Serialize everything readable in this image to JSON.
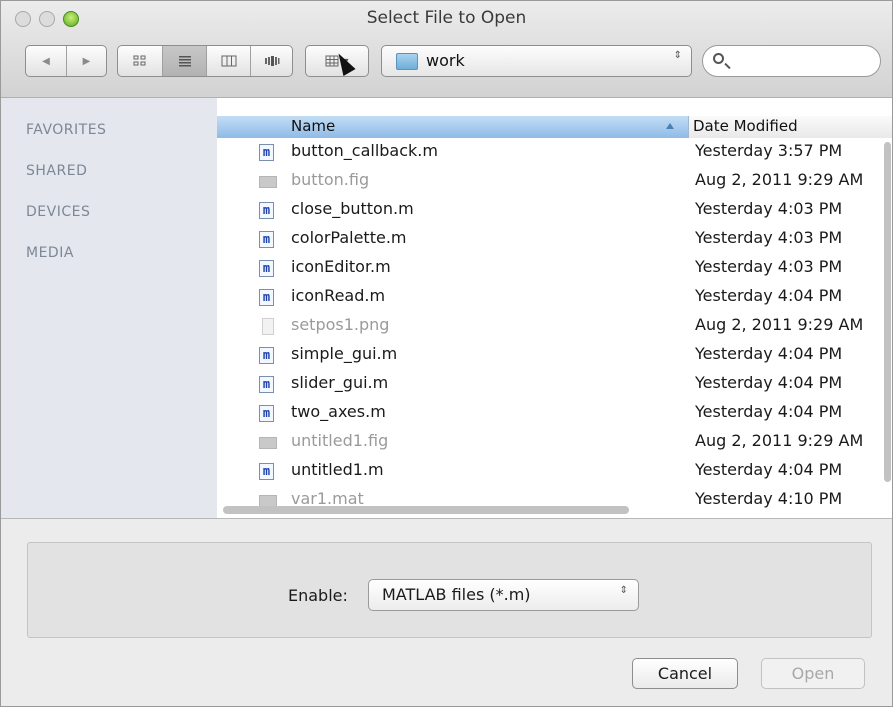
{
  "window": {
    "title": "Select File to Open"
  },
  "toolbar": {
    "back_glyph": "◀",
    "forward_glyph": "▶",
    "view_icons": [
      "icon-view-icon",
      "list-view-icon",
      "column-view-icon",
      "coverflow-view-icon"
    ],
    "arrange_glyph": "▾",
    "location": "work",
    "updown_glyph": "⇕",
    "search": {
      "placeholder": ""
    }
  },
  "sidebar": {
    "items": [
      {
        "label": "FAVORITES"
      },
      {
        "label": "SHARED"
      },
      {
        "label": "DEVICES"
      },
      {
        "label": "MEDIA"
      }
    ]
  },
  "filelist": {
    "columns": {
      "name": "Name",
      "date": "Date Modified"
    },
    "rows": [
      {
        "name": "button_callback.m",
        "date": "Yesterday 3:57 PM",
        "icon": "m",
        "dim": false
      },
      {
        "name": "button.fig",
        "date": "Aug 2, 2011 9:29 AM",
        "icon": "fig",
        "dim": true
      },
      {
        "name": "close_button.m",
        "date": "Yesterday 4:03 PM",
        "icon": "m",
        "dim": false
      },
      {
        "name": "colorPalette.m",
        "date": "Yesterday 4:03 PM",
        "icon": "m",
        "dim": false
      },
      {
        "name": "iconEditor.m",
        "date": "Yesterday 4:03 PM",
        "icon": "m",
        "dim": false
      },
      {
        "name": "iconRead.m",
        "date": "Yesterday 4:04 PM",
        "icon": "m",
        "dim": false
      },
      {
        "name": "setpos1.png",
        "date": "Aug 2, 2011 9:29 AM",
        "icon": "png",
        "dim": true
      },
      {
        "name": "simple_gui.m",
        "date": "Yesterday 4:04 PM",
        "icon": "m",
        "dim": false
      },
      {
        "name": "slider_gui.m",
        "date": "Yesterday 4:04 PM",
        "icon": "m",
        "dim": false
      },
      {
        "name": "two_axes.m",
        "date": "Yesterday 4:04 PM",
        "icon": "m",
        "dim": false
      },
      {
        "name": "untitled1.fig",
        "date": "Aug 2, 2011 9:29 AM",
        "icon": "fig",
        "dim": true
      },
      {
        "name": "untitled1.m",
        "date": "Yesterday 4:04 PM",
        "icon": "m",
        "dim": false
      },
      {
        "name": "var1.mat",
        "date": "Yesterday 4:10 PM",
        "icon": "fig",
        "dim": true
      }
    ]
  },
  "filter": {
    "label": "Enable:",
    "value": "MATLAB files (*.m)"
  },
  "buttons": {
    "cancel": "Cancel",
    "open": "Open"
  }
}
